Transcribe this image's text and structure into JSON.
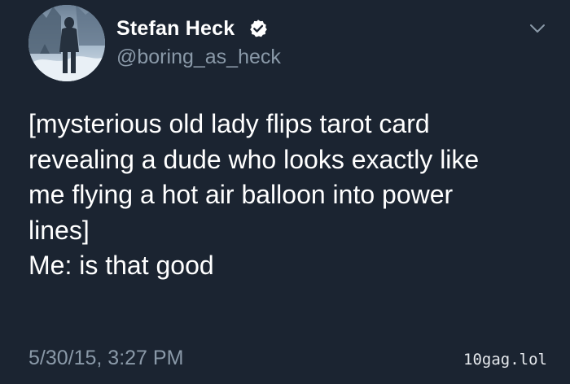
{
  "tweet": {
    "author": {
      "display_name": "Stefan Heck",
      "handle": "@boring_as_heck",
      "verified": true,
      "avatar_icon": "avatar-photo"
    },
    "text": "[mysterious old lady flips tarot card\nrevealing a dude who looks exactly like\nme flying a hot air balloon into power\nlines]\nMe: is that good",
    "timestamp": "5/30/15, 3:27 PM",
    "menu_icon": "chevron-down-icon",
    "verified_icon": "verified-badge-icon"
  },
  "watermark": "10gag.lol",
  "colors": {
    "background": "#1b2431",
    "primary_text": "#ffffff",
    "secondary_text": "#8a99a8"
  }
}
